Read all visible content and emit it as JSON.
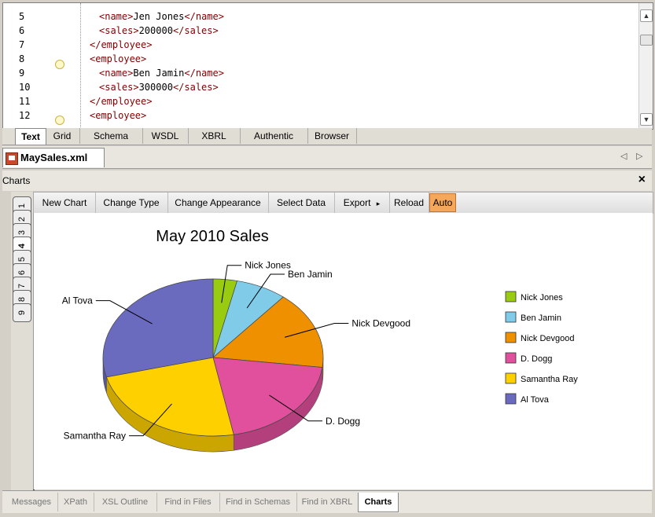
{
  "editor": {
    "lines": [
      {
        "num": "5",
        "indent": 2,
        "parts": [
          [
            "tag",
            "<name>"
          ],
          [
            "txt",
            "Jen Jones"
          ],
          [
            "tag",
            "</name>"
          ]
        ]
      },
      {
        "num": "6",
        "indent": 2,
        "parts": [
          [
            "tag",
            "<sales>"
          ],
          [
            "txt",
            "200000"
          ],
          [
            "tag",
            "</sales>"
          ]
        ]
      },
      {
        "num": "7",
        "indent": 1,
        "parts": [
          [
            "tag",
            "</employee>"
          ]
        ]
      },
      {
        "num": "8",
        "indent": 1,
        "parts": [
          [
            "tag",
            "<employee>"
          ]
        ]
      },
      {
        "num": "9",
        "indent": 2,
        "parts": [
          [
            "tag",
            "<name>"
          ],
          [
            "txt",
            "Ben Jamin"
          ],
          [
            "tag",
            "</name>"
          ]
        ]
      },
      {
        "num": "10",
        "indent": 2,
        "parts": [
          [
            "tag",
            "<sales>"
          ],
          [
            "txt",
            "300000"
          ],
          [
            "tag",
            "</sales>"
          ]
        ]
      },
      {
        "num": "11",
        "indent": 1,
        "parts": [
          [
            "tag",
            "</employee>"
          ]
        ]
      },
      {
        "num": "12",
        "indent": 1,
        "parts": [
          [
            "tag",
            "<employee>"
          ]
        ]
      }
    ]
  },
  "view_tabs": [
    "Text",
    "Grid",
    "Schema",
    "WSDL",
    "XBRL",
    "Authentic",
    "Browser"
  ],
  "active_view_tab": "Text",
  "file_tab": {
    "label": "MaySales.xml"
  },
  "charts_header": {
    "title": "Charts",
    "close": "×"
  },
  "toolbar": {
    "new_chart": "New Chart",
    "change_type": "Change Type",
    "change_appearance": "Change Appearance",
    "select_data": "Select Data",
    "export": "Export",
    "export_arrow": "▸",
    "reload": "Reload",
    "auto": "Auto"
  },
  "side_tabs": [
    "1",
    "2",
    "3",
    "4",
    "5",
    "6",
    "7",
    "8",
    "9"
  ],
  "active_side_tab": "4",
  "bottom_tabs": [
    "Messages",
    "XPath",
    "XSL Outline",
    "Find in Files",
    "Find in Schemas",
    "Find in XBRL",
    "Charts"
  ],
  "active_bottom_tab": "Charts",
  "chart_data": {
    "type": "pie",
    "title": "May 2010 Sales",
    "legend_position": "right",
    "slices": [
      {
        "name": "Nick Jones",
        "value": 3.5,
        "color": "#99cc11"
      },
      {
        "name": "Ben Jamin",
        "value": 7.5,
        "color": "#7fcbe8"
      },
      {
        "name": "Nick Devgood",
        "value": 16,
        "color": "#ee9000"
      },
      {
        "name": "D. Dogg",
        "value": 20,
        "color": "#e0509c"
      },
      {
        "name": "Samantha Ray",
        "value": 24,
        "color": "#ffd000"
      },
      {
        "name": "Al Tova",
        "value": 29,
        "color": "#6a6abf"
      }
    ]
  }
}
